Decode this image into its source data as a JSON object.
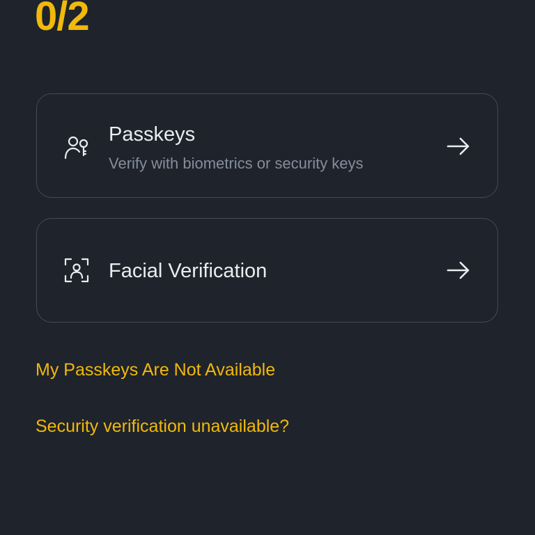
{
  "header": {
    "progress": "0/2"
  },
  "options": {
    "passkeys": {
      "icon": "user-key-icon",
      "title": "Passkeys",
      "subtitle": "Verify with biometrics or security keys",
      "arrow_icon": "arrow-right-icon"
    },
    "facial": {
      "icon": "face-scan-icon",
      "title": "Facial Verification",
      "arrow_icon": "arrow-right-icon"
    }
  },
  "links": {
    "passkeys_unavailable": "My Passkeys Are Not Available",
    "security_unavailable": "Security verification unavailable?"
  },
  "colors": {
    "background": "#1f232b",
    "accent": "#f0b90b",
    "card_border": "#454b55",
    "text_primary": "#eaecef",
    "text_secondary": "#848e9c"
  }
}
